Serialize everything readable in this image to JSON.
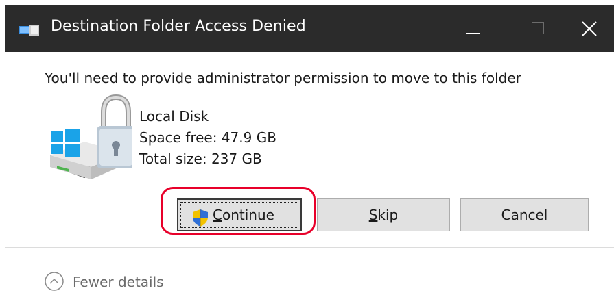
{
  "window": {
    "title": "Destination Folder Access Denied",
    "titlebar_color": "#2b2b2b",
    "minimize_icon": "minimize-icon",
    "maximize_icon": "maximize-icon",
    "close_icon": "close-icon"
  },
  "message": "You'll need to provide administrator permission to move to this folder",
  "drive": {
    "name": "Local Disk",
    "space_free": "Space free: 47.9 GB",
    "total_size": "Total size: 237 GB",
    "icon": "locked-drive-icon"
  },
  "buttons": {
    "continue": {
      "label": "Continue",
      "icon": "uac-shield-icon",
      "focused": true
    },
    "skip": {
      "label": "Skip"
    },
    "cancel": {
      "label": "Cancel"
    }
  },
  "annotation": {
    "highlight_color": "#e8002a"
  },
  "footer": {
    "toggle_label": "Fewer details",
    "toggle_icon": "chevron-up-circle-icon"
  }
}
